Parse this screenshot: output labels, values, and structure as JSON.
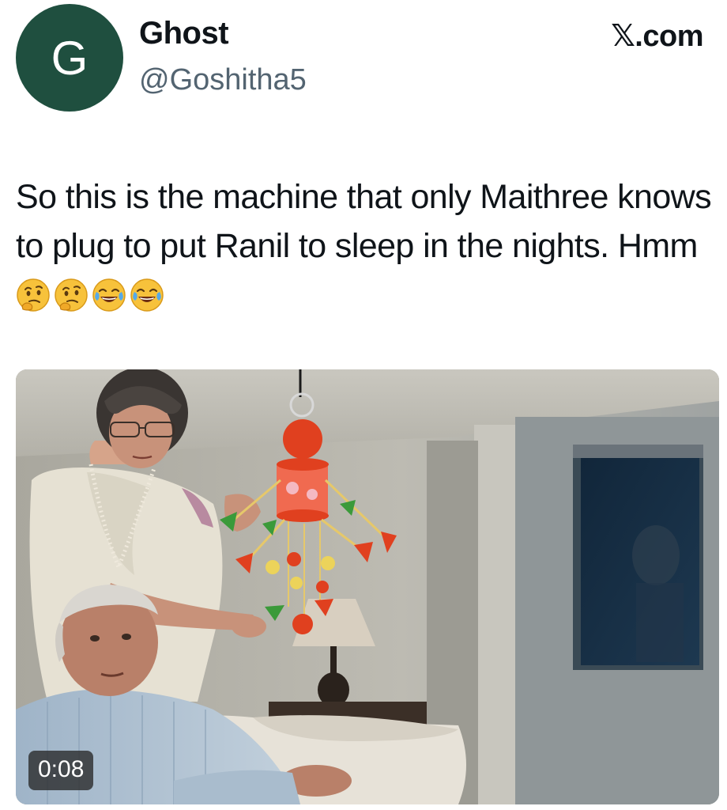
{
  "author": {
    "avatar_letter": "G",
    "display_name": "Ghost",
    "handle": "@Goshitha5"
  },
  "source": {
    "label": "𝕏.com"
  },
  "tweet": {
    "text": "So this is the machine that only Maithree knows to plug to put Ranil to sleep in the nights. Hmm",
    "emojis": [
      "thinking-face",
      "thinking-face",
      "face-with-tears-of-joy",
      "face-with-tears-of-joy"
    ]
  },
  "media": {
    "type": "video",
    "duration": "0:08"
  },
  "colors": {
    "avatar_bg": "#1f4f3f",
    "handle_text": "#536471",
    "primary_text": "#0f1419"
  }
}
